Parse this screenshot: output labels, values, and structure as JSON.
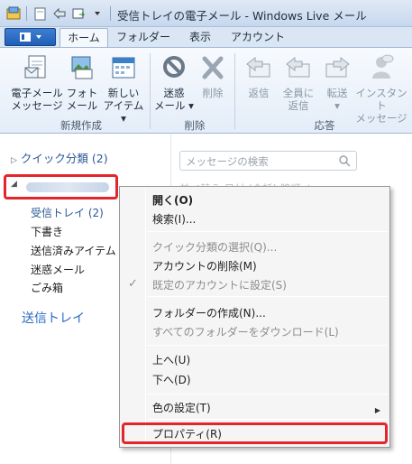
{
  "window": {
    "title": "受信トレイの電子メール - Windows Live メール"
  },
  "tabs": [
    "ホーム",
    "フォルダー",
    "表示",
    "アカウント"
  ],
  "ribbon": {
    "new_group": {
      "label": "新規作成",
      "email": "電子メール\nメッセージ",
      "photo": "フォト\nメール",
      "item": "新しい\nアイテム ▾"
    },
    "delete_group": {
      "label": "削除",
      "junk": "迷惑\nメール ▾",
      "delete": "削除"
    },
    "respond_group": {
      "label": "応答",
      "reply": "返信",
      "reply_all": "全員に\n返信",
      "forward": "転送\n▾",
      "im": "インスタント\nメッセージ"
    }
  },
  "left_pane": {
    "quick_views": "クイック分類 (2)",
    "folders": [
      "受信トレイ (2)",
      "下書き",
      "送信済みアイテム",
      "迷惑メール",
      "ごみ箱"
    ],
    "outbox": "送信トレイ"
  },
  "right_pane": {
    "search_placeholder": "メッセージの検索",
    "faded_header": "並べ替え 日付 (会話)    降順 ↓"
  },
  "context_menu": {
    "open": "開く(O)",
    "search": "検索(I)...",
    "quick_views_select": "クイック分類の選択(Q)...",
    "delete_account": "アカウントの削除(M)",
    "set_default": "既定のアカウントに設定(S)",
    "create_folder": "フォルダーの作成(N)...",
    "download_all": "すべてのフォルダーをダウンロード(L)",
    "move_up": "上へ(U)",
    "move_down": "下へ(D)",
    "color": "色の設定(T)",
    "properties": "プロパティ(R)"
  },
  "colors": {
    "highlight": "#e3262c",
    "accent": "#2b6cc4"
  }
}
